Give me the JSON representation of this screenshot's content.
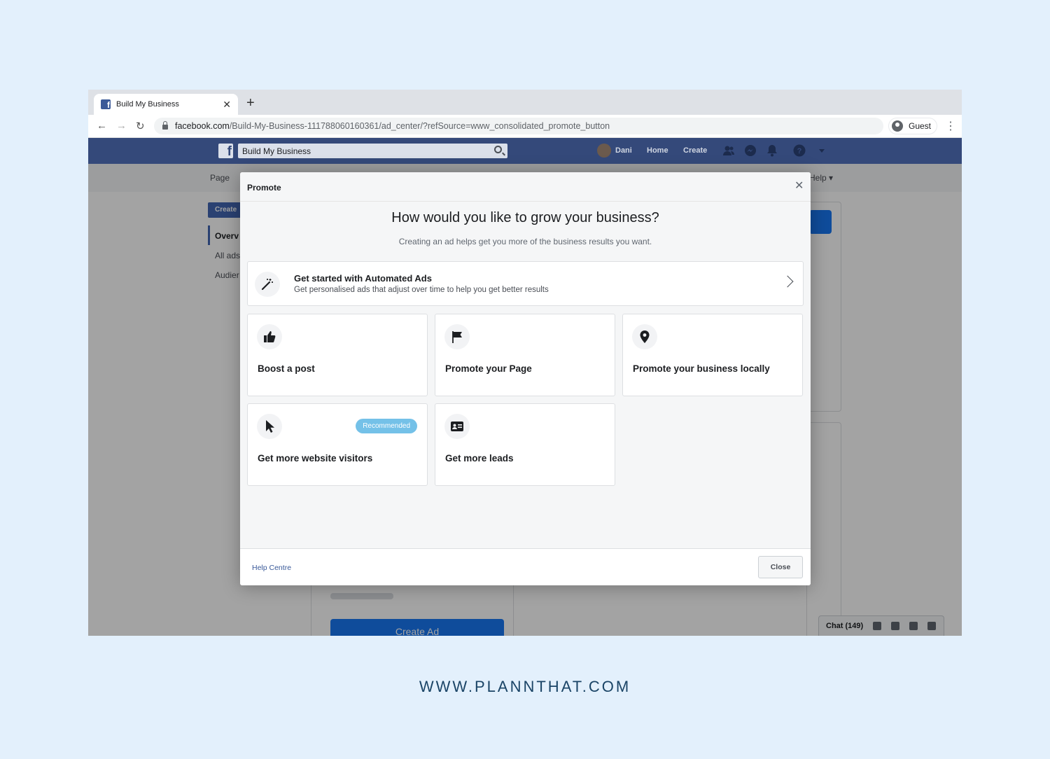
{
  "browser": {
    "tab_title": "Build My Business",
    "url_host": "facebook.com",
    "url_path": "/Build-My-Business-111788060160361/ad_center/?refSource=www_consolidated_promote_button",
    "profile_label": "Guest"
  },
  "fb_header": {
    "search_value": "Build My Business",
    "user_name": "Dani",
    "home_label": "Home",
    "create_label": "Create"
  },
  "subbar": {
    "page_label": "Page",
    "help_label": "Help ▾"
  },
  "background": {
    "create_button": "Create",
    "left_items": [
      "Overv",
      "All ads",
      "Audier"
    ],
    "create_ad_button": "Create Ad",
    "chat_label": "Chat (149)"
  },
  "modal": {
    "title": "Promote",
    "heading": "How would you like to grow your business?",
    "subheading": "Creating an ad helps get you more of the business results you want.",
    "automated": {
      "title": "Get started with Automated Ads",
      "description": "Get personalised ads that adjust over time to help you get better results"
    },
    "options": [
      {
        "label": "Boost a post",
        "icon": "thumbs-up-icon"
      },
      {
        "label": "Promote your Page",
        "icon": "flag-icon"
      },
      {
        "label": "Promote your business locally",
        "icon": "location-pin-icon"
      },
      {
        "label": "Get more website visitors",
        "icon": "cursor-icon",
        "badge": "Recommended"
      },
      {
        "label": "Get more leads",
        "icon": "contact-card-icon"
      }
    ],
    "help_link": "Help Centre",
    "close_button": "Close"
  },
  "watermark": "WWW.PLANNTHAT.COM"
}
